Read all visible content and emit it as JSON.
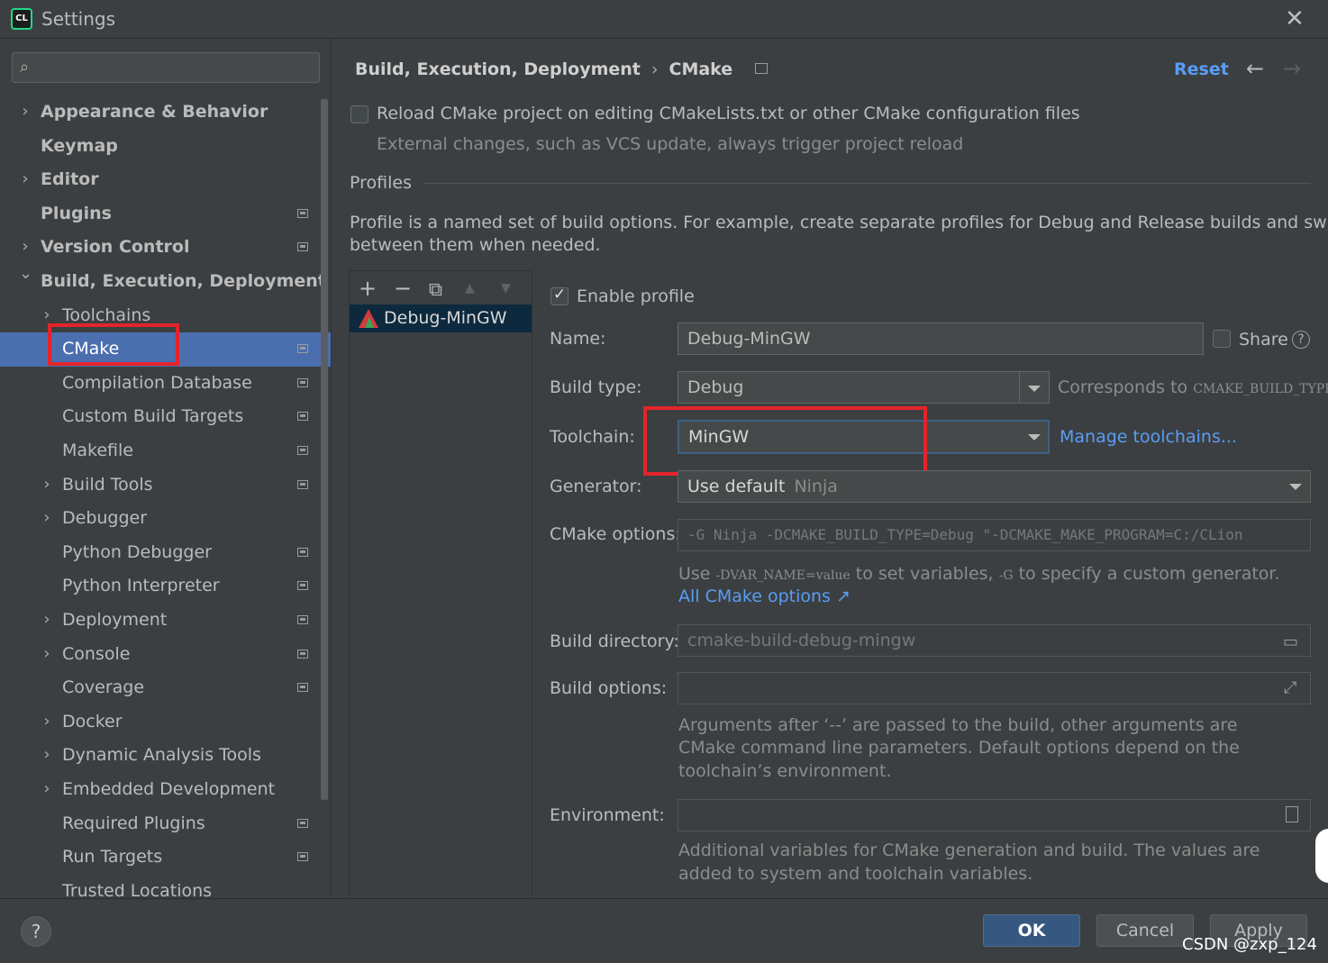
{
  "window": {
    "title": "Settings",
    "logo_text": "CL"
  },
  "search": {
    "placeholder": ""
  },
  "tree": [
    {
      "label": "Appearance & Behavior",
      "level": "top",
      "arrow": "collapsed",
      "doc": false
    },
    {
      "label": "Keymap",
      "level": "top",
      "arrow": "none",
      "doc": false
    },
    {
      "label": "Editor",
      "level": "top",
      "arrow": "collapsed",
      "doc": false
    },
    {
      "label": "Plugins",
      "level": "top",
      "arrow": "none",
      "doc": true
    },
    {
      "label": "Version Control",
      "level": "top",
      "arrow": "collapsed",
      "doc": true
    },
    {
      "label": "Build, Execution, Deployment",
      "level": "top",
      "arrow": "expanded",
      "doc": false
    },
    {
      "label": "Toolchains",
      "level": "child",
      "arrow": "collapsed",
      "doc": false
    },
    {
      "label": "CMake",
      "level": "child",
      "arrow": "none",
      "doc": true,
      "selected": true
    },
    {
      "label": "Compilation Database",
      "level": "child",
      "arrow": "none",
      "doc": true
    },
    {
      "label": "Custom Build Targets",
      "level": "child",
      "arrow": "none",
      "doc": true
    },
    {
      "label": "Makefile",
      "level": "child",
      "arrow": "none",
      "doc": true
    },
    {
      "label": "Build Tools",
      "level": "child",
      "arrow": "collapsed",
      "doc": true
    },
    {
      "label": "Debugger",
      "level": "child",
      "arrow": "collapsed",
      "doc": false
    },
    {
      "label": "Python Debugger",
      "level": "child",
      "arrow": "none",
      "doc": true
    },
    {
      "label": "Python Interpreter",
      "level": "child",
      "arrow": "none",
      "doc": true
    },
    {
      "label": "Deployment",
      "level": "child",
      "arrow": "collapsed",
      "doc": true
    },
    {
      "label": "Console",
      "level": "child",
      "arrow": "collapsed",
      "doc": true
    },
    {
      "label": "Coverage",
      "level": "child",
      "arrow": "none",
      "doc": true
    },
    {
      "label": "Docker",
      "level": "child",
      "arrow": "collapsed",
      "doc": false
    },
    {
      "label": "Dynamic Analysis Tools",
      "level": "child",
      "arrow": "collapsed",
      "doc": false
    },
    {
      "label": "Embedded Development",
      "level": "child",
      "arrow": "collapsed",
      "doc": false
    },
    {
      "label": "Required Plugins",
      "level": "child",
      "arrow": "none",
      "doc": true
    },
    {
      "label": "Run Targets",
      "level": "child",
      "arrow": "none",
      "doc": true
    },
    {
      "label": "Trusted Locations",
      "level": "child",
      "arrow": "none",
      "doc": false
    }
  ],
  "header": {
    "breadcrumb_parent": "Build, Execution, Deployment",
    "breadcrumb_sep": "›",
    "breadcrumb_current": "CMake",
    "reset": "Reset",
    "back": "←",
    "forward": "→"
  },
  "reload": {
    "label": "Reload CMake project on editing CMakeLists.txt or other CMake configuration files",
    "hint": "External changes, such as VCS update, always trigger project reload",
    "checked": false
  },
  "profiles": {
    "section_title": "Profiles",
    "description_line1": "Profile is a named set of build options. For example, create separate profiles for Debug and Release builds and switch",
    "description_line2": "between them when needed.",
    "toolbar": {
      "add": "+",
      "remove": "−",
      "copy": "⧉",
      "up": "▲",
      "down": "▼"
    },
    "items": [
      "Debug-MinGW"
    ]
  },
  "form": {
    "enable_profile": "Enable profile",
    "name_label": "Name:",
    "name_value": "Debug-MinGW",
    "share": "Share",
    "help": "?",
    "build_type_label": "Build type:",
    "build_type_value": "Debug",
    "build_type_hint_prefix": "Corresponds to",
    "build_type_hint_code": "CMAKE_BUILD_TYPE",
    "toolchain_label": "Toolchain:",
    "toolchain_value": "MinGW",
    "manage_toolchains": "Manage toolchains...",
    "generator_label": "Generator:",
    "generator_value": "Use default",
    "generator_default": "Ninja",
    "cmake_options_label": "CMake options:",
    "cmake_options_value": "-G Ninja -DCMAKE_BUILD_TYPE=Debug \"-DCMAKE_MAKE_PROGRAM=C:/CLion",
    "cmake_hint_1": "Use",
    "cmake_hint_code1": "-DVAR_NAME=value",
    "cmake_hint_2": "to set variables,",
    "cmake_hint_code2": "-G",
    "cmake_hint_3": "to specify a custom generator.",
    "all_cmake_options": "All CMake options ↗",
    "build_dir_label": "Build directory:",
    "build_dir_value": "cmake-build-debug-mingw",
    "build_options_label": "Build options:",
    "build_options_value": "",
    "build_options_hint1": "Arguments after ‘--’ are passed to the build, other arguments are",
    "build_options_hint2": "CMake command line parameters. Default options depend on the",
    "build_options_hint3": "toolchain’s environment.",
    "environment_label": "Environment:",
    "environment_value": "",
    "environment_hint1": "Additional variables for CMake generation and build. The values are",
    "environment_hint2": "added to system and toolchain variables."
  },
  "footer": {
    "help": "?",
    "ok": "OK",
    "cancel": "Cancel",
    "apply": "Apply",
    "watermark": "CSDN @zxp_124"
  },
  "colors": {
    "background": "#3c3f41",
    "selection": "#4b6eaf",
    "link": "#589df6",
    "highlight_box": "#e3242b",
    "ok_button": "#365880"
  }
}
